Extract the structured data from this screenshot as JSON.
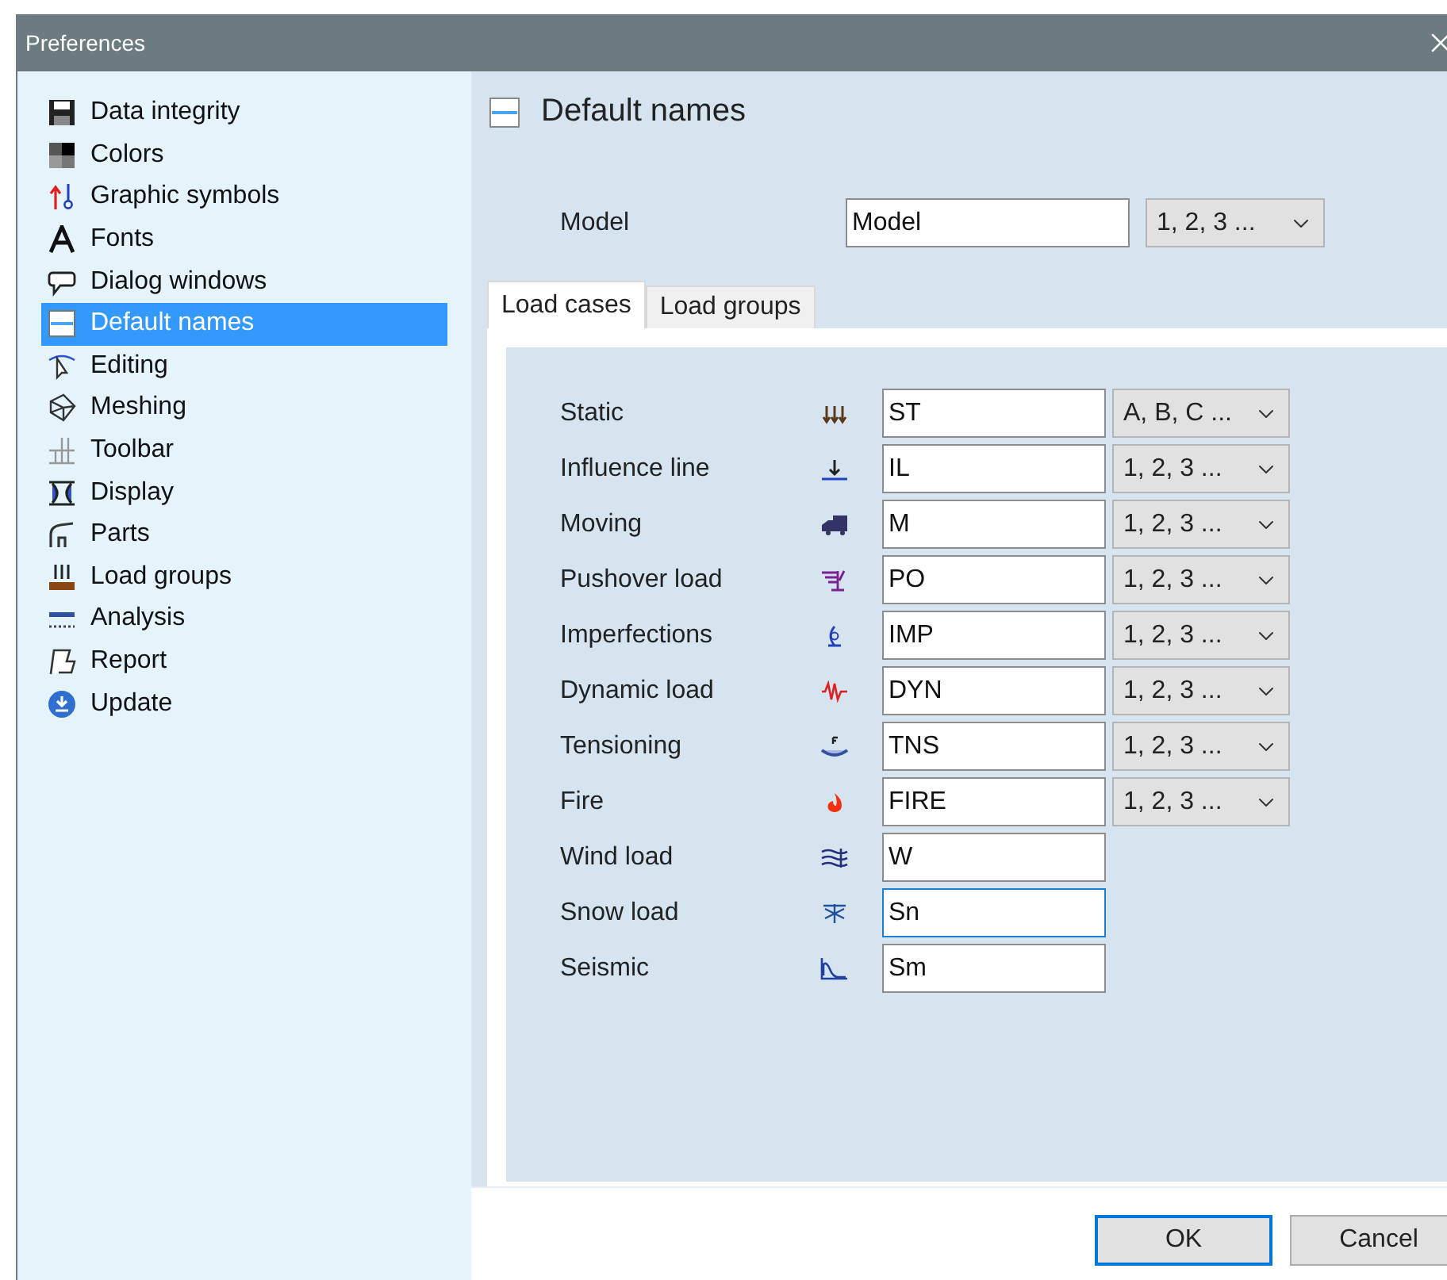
{
  "window": {
    "title": "Preferences"
  },
  "sidebar": {
    "items": [
      {
        "label": "Data integrity",
        "selected": false
      },
      {
        "label": "Colors",
        "selected": false
      },
      {
        "label": "Graphic symbols",
        "selected": false
      },
      {
        "label": "Fonts",
        "selected": false
      },
      {
        "label": "Dialog windows",
        "selected": false
      },
      {
        "label": "Default names",
        "selected": true
      },
      {
        "label": "Editing",
        "selected": false
      },
      {
        "label": "Meshing",
        "selected": false
      },
      {
        "label": "Toolbar",
        "selected": false
      },
      {
        "label": "Display",
        "selected": false
      },
      {
        "label": "Parts",
        "selected": false
      },
      {
        "label": "Load groups",
        "selected": false
      },
      {
        "label": "Analysis",
        "selected": false
      },
      {
        "label": "Report",
        "selected": false
      },
      {
        "label": "Update",
        "selected": false
      }
    ]
  },
  "panel": {
    "title": "Default names",
    "model": {
      "label": "Model",
      "value": "Model",
      "numbering": "1, 2, 3 ..."
    },
    "tabs": [
      {
        "label": "Load cases",
        "selected": true
      },
      {
        "label": "Load groups",
        "selected": false
      }
    ],
    "rows": [
      {
        "label": "Static",
        "value": "ST",
        "numbering": "A, B, C ...",
        "focused": false
      },
      {
        "label": "Influence line",
        "value": "IL",
        "numbering": "1, 2, 3 ...",
        "focused": false
      },
      {
        "label": "Moving",
        "value": "M",
        "numbering": "1, 2, 3 ...",
        "focused": false
      },
      {
        "label": "Pushover load",
        "value": "PO",
        "numbering": "1, 2, 3 ...",
        "focused": false
      },
      {
        "label": "Imperfections",
        "value": "IMP",
        "numbering": "1, 2, 3 ...",
        "focused": false
      },
      {
        "label": "Dynamic load",
        "value": "DYN",
        "numbering": "1, 2, 3 ...",
        "focused": false
      },
      {
        "label": "Tensioning",
        "value": "TNS",
        "numbering": "1, 2, 3 ...",
        "focused": false
      },
      {
        "label": "Fire",
        "value": "FIRE",
        "numbering": "1, 2, 3 ...",
        "focused": false
      },
      {
        "label": "Wind load",
        "value": "W",
        "focused": false
      },
      {
        "label": "Snow load",
        "value": "Sn",
        "focused": true
      },
      {
        "label": "Seismic",
        "value": "Sm",
        "focused": false
      }
    ]
  },
  "buttons": [
    {
      "label": "OK",
      "default": true
    },
    {
      "label": "Cancel",
      "default": false
    }
  ]
}
